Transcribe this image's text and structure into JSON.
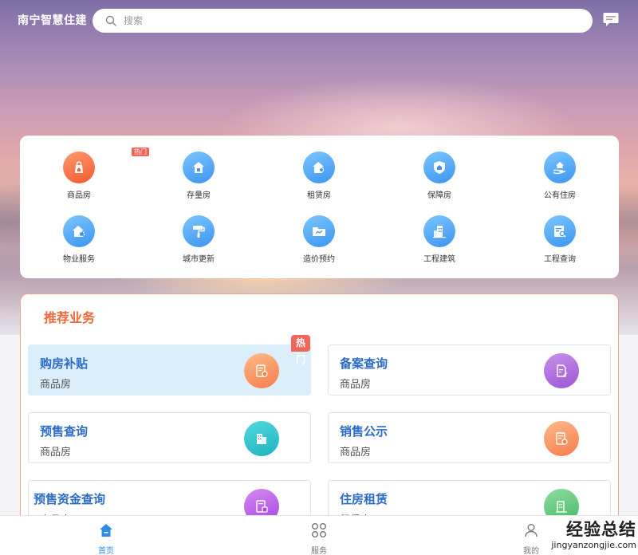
{
  "header": {
    "app_title": "南宁智慧住建",
    "search_placeholder": "搜索"
  },
  "quick_grid": {
    "hot_label": "热门",
    "items": [
      {
        "label": "商品房",
        "icon": "house-bag-icon",
        "color": "#f45c2c"
      },
      {
        "label": "存量房",
        "icon": "house-icon",
        "color": "#3d95f0"
      },
      {
        "label": "租赁房",
        "icon": "house-key-icon",
        "color": "#3d95f0"
      },
      {
        "label": "保障房",
        "icon": "shield-icon",
        "color": "#3d95f0"
      },
      {
        "label": "公有住房",
        "icon": "hand-house-icon",
        "color": "#3d95f0"
      },
      {
        "label": "物业服务",
        "icon": "house-gear-icon",
        "color": "#3d95f0"
      },
      {
        "label": "城市更新",
        "icon": "paint-roller-icon",
        "color": "#3d95f0"
      },
      {
        "label": "造价预约",
        "icon": "folder-icon",
        "color": "#3d95f0"
      },
      {
        "label": "工程建筑",
        "icon": "building-icon",
        "color": "#3d95f0"
      },
      {
        "label": "工程查询",
        "icon": "document-search-icon",
        "color": "#3d95f0"
      }
    ]
  },
  "recommend": {
    "title": "推荐业务",
    "hot_label": "热门",
    "items": [
      {
        "title": "购房补贴",
        "subtitle": "商品房",
        "icon": "document-seal-icon"
      },
      {
        "title": "备案查询",
        "subtitle": "商品房",
        "icon": "document-edit-icon"
      },
      {
        "title": "预售查询",
        "subtitle": "商品房",
        "icon": "buildings-icon"
      },
      {
        "title": "销售公示",
        "subtitle": "商品房",
        "icon": "document-seal-icon"
      },
      {
        "title": "预售资金查询",
        "subtitle": "商品房",
        "icon": "document-money-icon"
      },
      {
        "title": "住房租赁",
        "subtitle": "租赁房",
        "icon": "building-icon"
      }
    ]
  },
  "bottom_nav": {
    "items": [
      {
        "label": "首页",
        "icon": "home-icon",
        "active": true
      },
      {
        "label": "服务",
        "icon": "grid-icon",
        "active": false
      },
      {
        "label": "我的",
        "icon": "user-icon",
        "active": false
      }
    ]
  },
  "watermark": {
    "top": "经验总结",
    "bottom": "jingyanzongjie.com"
  }
}
